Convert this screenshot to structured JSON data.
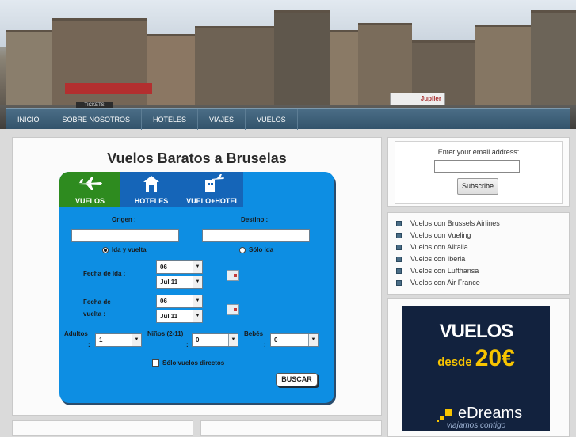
{
  "header": {
    "truck_text": "Jupiler",
    "tickets_sign": "TICKETS"
  },
  "nav": {
    "items": [
      "INICIO",
      "SOBRE NOSOTROS",
      "HOTELES",
      "VIAJES",
      "VUELOS"
    ]
  },
  "main": {
    "title": "Vuelos Baratos a Bruselas",
    "widget": {
      "tabs": [
        "VUELOS",
        "HOTELES",
        "VUELO+HOTEL"
      ],
      "origin_label": "Origen :",
      "destination_label": "Destino :",
      "origin_value": "",
      "destination_value": "",
      "trip_round": "Ida y vuelta",
      "trip_oneway": "Sólo ida",
      "depart_label": "Fecha de ida :",
      "return_label_1": "Fecha de",
      "return_label_2": "vuelta :",
      "depart_day": "06",
      "depart_month": "Jul 11",
      "return_day": "06",
      "return_month": "Jul 11",
      "adults_label": "Adultos",
      "adults_value": "1",
      "children_label": "Niños (2-11)",
      "children_value": "0",
      "babies_label": "Bebés",
      "babies_value": "0",
      "colon": ":",
      "direct_only": "Sólo vuelos directos",
      "search_button": "BUSCAR"
    }
  },
  "sidebar": {
    "subscribe": {
      "label": "Enter your email address:",
      "email_value": "",
      "button": "Subscribe"
    },
    "links": [
      "Vuelos con Brussels Airlines",
      "Vuelos con Vueling",
      "Vuelos con Alitalia",
      "Vuelos con Iberia",
      "Vuelos con Lufthansa",
      "Vuelos con Air France"
    ],
    "ad": {
      "headline": "VUELOS",
      "desde": "desde",
      "price": "20€",
      "brand": "eDreams",
      "tagline": "viajamos contigo"
    }
  },
  "colors": {
    "nav_bg": "#3f6077",
    "widget_blue": "#0d8ee3",
    "tab_active": "#2e8b1f",
    "tab_inactive": "#1565b8"
  }
}
